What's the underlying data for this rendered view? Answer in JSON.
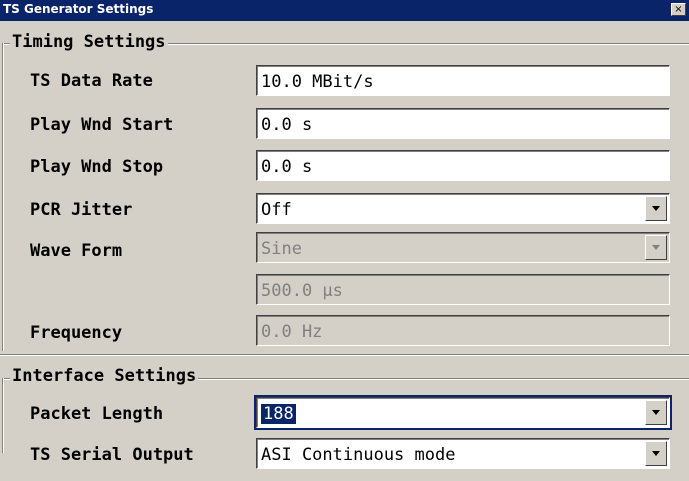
{
  "window": {
    "title": "TS Generator Settings",
    "close_glyph": "×"
  },
  "timing": {
    "section_title": "Timing Settings",
    "ts_data_rate": {
      "label": "TS Data Rate",
      "value": "10.0 MBit/s"
    },
    "play_wnd_start": {
      "label": "Play Wnd Start",
      "value": "0.0 s"
    },
    "play_wnd_stop": {
      "label": "Play Wnd Stop",
      "value": "0.0 s"
    },
    "pcr_jitter": {
      "label": "PCR Jitter",
      "value": "Off"
    },
    "wave_form": {
      "label": "Wave Form",
      "value": "Sine"
    },
    "period": {
      "value": "500.0 µs"
    },
    "frequency": {
      "label": "Frequency",
      "value": "0.0 Hz"
    }
  },
  "interface": {
    "section_title": "Interface Settings",
    "packet_length": {
      "label": "Packet Length",
      "value": "188"
    },
    "ts_serial_output": {
      "label": "TS Serial Output",
      "value": "ASI Continuous mode"
    }
  },
  "colors": {
    "titlebar": "#0a246a",
    "background": "#d4d0c8",
    "disabled_text": "#808080"
  },
  "icons": {
    "close": "close-icon",
    "dropdown": "chevron-down-icon"
  }
}
